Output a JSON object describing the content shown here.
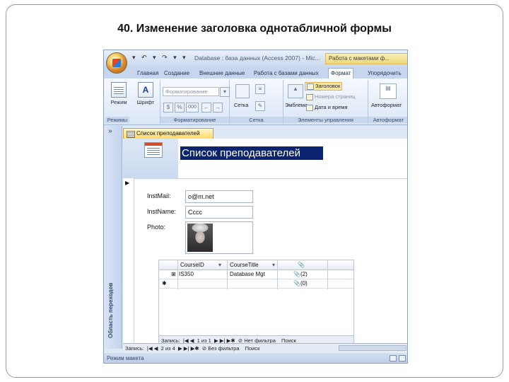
{
  "slide": {
    "title": "40. Изменение заголовка однотабличной формы"
  },
  "titlebar": {
    "qat": "▾ ↶ ▾ ↷ ▾ ▾",
    "title": "Database : база данных (Access 2007) - Mic...",
    "context_tab": "Работа с макетами ф..."
  },
  "ribbon_tabs": [
    "Главная",
    "Создание",
    "Внешние данные",
    "Работа с базами данных",
    "Формат",
    "Упорядочить"
  ],
  "ribbon": {
    "groups": {
      "views": "Режимы",
      "formatting": "Форматирование",
      "gridlines": "Сетка",
      "controls": "Элементы управления",
      "autoformat": "Автоформат"
    },
    "buttons": {
      "mode": "Режим",
      "font": "Шрифт",
      "format_dropdown": "Форматирование",
      "grid": "Сетка",
      "emblem": "Эмблема",
      "title": "Заголовок",
      "page_numbers": "Номера страниц",
      "date_time": "Дата и время",
      "autoformat": "Автоформат",
      "percent": "%",
      "thousands": "000"
    }
  },
  "nav_pane": {
    "label": "Область переходов",
    "chevron": "»"
  },
  "document": {
    "tab_label": "Список преподавателей",
    "header_title": "Список преподавателей",
    "record_selector": "▶",
    "fields": [
      {
        "label": "InstMail:",
        "value": "o@m.net"
      },
      {
        "label": "InstName:",
        "value": "Cccc"
      },
      {
        "label": "Photo:",
        "value": ""
      }
    ],
    "subform": {
      "columns": [
        "CourseID",
        "CourseTitle",
        "📎"
      ],
      "rows": [
        {
          "marker": "⊞",
          "id": "IS350",
          "title": "Database Mgt",
          "attach": "📎(2)"
        },
        {
          "marker": "✱",
          "id": "",
          "title": "",
          "attach": "📎(0)"
        }
      ],
      "nav": {
        "label": "Запись:",
        "position": "1 из 1",
        "filter": "Нет фильтра",
        "search": "Поиск"
      }
    },
    "main_nav": {
      "label": "Запись:",
      "position": "2 из 4",
      "filter": "Без фильтра",
      "search": "Поиск"
    }
  },
  "status": {
    "text": "Режим макета"
  }
}
